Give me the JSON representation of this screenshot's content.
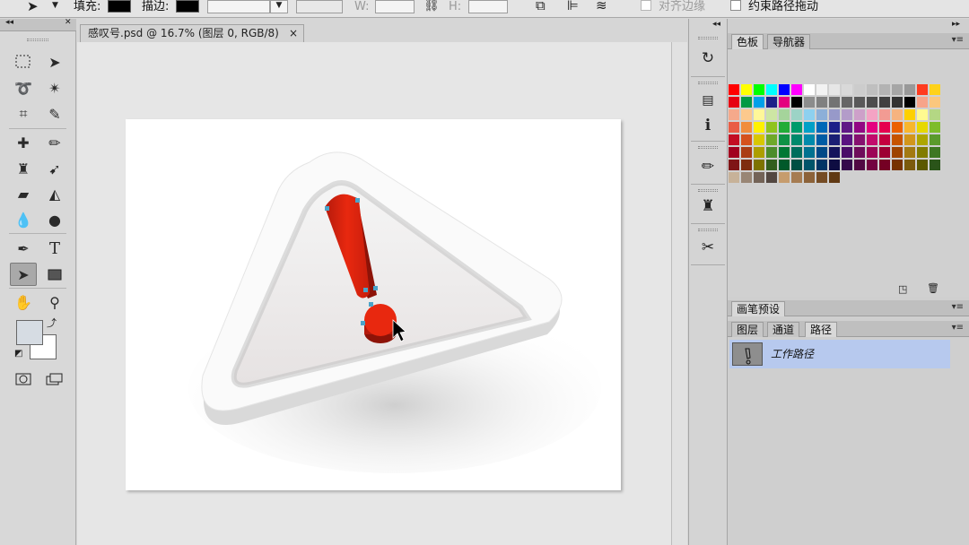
{
  "options_bar": {
    "fill_label": "填充:",
    "stroke_label": "描边:",
    "w_label": "W:",
    "h_label": "H:",
    "align_edges_label": "对齐边缘",
    "constrain_path_label": "约束路径拖动"
  },
  "document": {
    "tab_title": "感叹号.psd @ 16.7% (图层 0, RGB/8)",
    "close_glyph": "×"
  },
  "swatch_panel": {
    "tabs": [
      "色板",
      "导航器"
    ],
    "rows": [
      [
        "#ff0000",
        "#ffff00",
        "#00ff00",
        "#00ffff",
        "#0000ff",
        "#ff00ff",
        "#ffffff",
        "#f2f2f2",
        "#e6e6e6",
        "#d9d9d9",
        "#cccccc",
        "#bfbfbf",
        "#b3b3b3",
        "#a6a6a6",
        "#999999",
        "#ff3b1f",
        "#ffd21a"
      ],
      [
        "#e60012",
        "#009944",
        "#00a0e9",
        "#1d2088",
        "#e4007f",
        "#000000",
        "#8c8c8c",
        "#808080",
        "#737373",
        "#666666",
        "#595959",
        "#4d4d4d",
        "#404040",
        "#333333",
        "#000000",
        "#f7a48a",
        "#fbc77d"
      ],
      [
        "#f5a98b",
        "#fcc98d",
        "#fff799",
        "#cde6a4",
        "#a5d49b",
        "#9cd3c6",
        "#8dd0ef",
        "#8cafd8",
        "#9799c9",
        "#b39cc9",
        "#cda0c9",
        "#f4a3c4",
        "#f29b93",
        "#f6b37f",
        "#fdd000",
        "#fffa91",
        "#b4d784"
      ],
      [
        "#e95d45",
        "#f08d3d",
        "#fff100",
        "#8fc31f",
        "#22ac38",
        "#009b6b",
        "#00a0c6",
        "#0068b7",
        "#1d2088",
        "#601986",
        "#920783",
        "#e4007f",
        "#e5004f",
        "#eb6100",
        "#f8b62d",
        "#e6d800",
        "#7ebc29"
      ],
      [
        "#c30d23",
        "#d5521c",
        "#d8c700",
        "#6ea829",
        "#0e9245",
        "#00896b",
        "#008aab",
        "#005ba4",
        "#1a1e74",
        "#5a1480",
        "#86116f",
        "#c20a6b",
        "#c4003e",
        "#c65400",
        "#d2961b",
        "#ada600",
        "#5a9a2c"
      ],
      [
        "#a1001f",
        "#aa3d14",
        "#ad9e00",
        "#4c8c2b",
        "#007834",
        "#006e5c",
        "#007290",
        "#004987",
        "#14145c",
        "#4a0e68",
        "#6f0c5b",
        "#9c0556",
        "#9d0033",
        "#9e4300",
        "#a37911",
        "#817c00",
        "#3e7723"
      ],
      [
        "#7f1416",
        "#7e2d0f",
        "#7d7300",
        "#325e1e",
        "#00592a",
        "#004f43",
        "#00546a",
        "#003465",
        "#0e0d42",
        "#35094b",
        "#510843",
        "#730340",
        "#750024",
        "#773200",
        "#7b5a0d",
        "#5c5900",
        "#2a5419"
      ],
      [
        "#c7b299",
        "#998675",
        "#736357",
        "#534741",
        "#c69c6d",
        "#a67c52",
        "#8c6239",
        "#754c24",
        "#603913"
      ]
    ]
  },
  "bottom_panels": {
    "brush_tab": "画笔预设",
    "tabs": [
      "图层",
      "通道",
      "路径"
    ],
    "path_name": "工作路径"
  },
  "icons": {
    "dock": [
      "history-icon",
      "properties-icon",
      "info-icon",
      "brush-icon",
      "clone-source-icon",
      "tool-presets-icon"
    ]
  }
}
